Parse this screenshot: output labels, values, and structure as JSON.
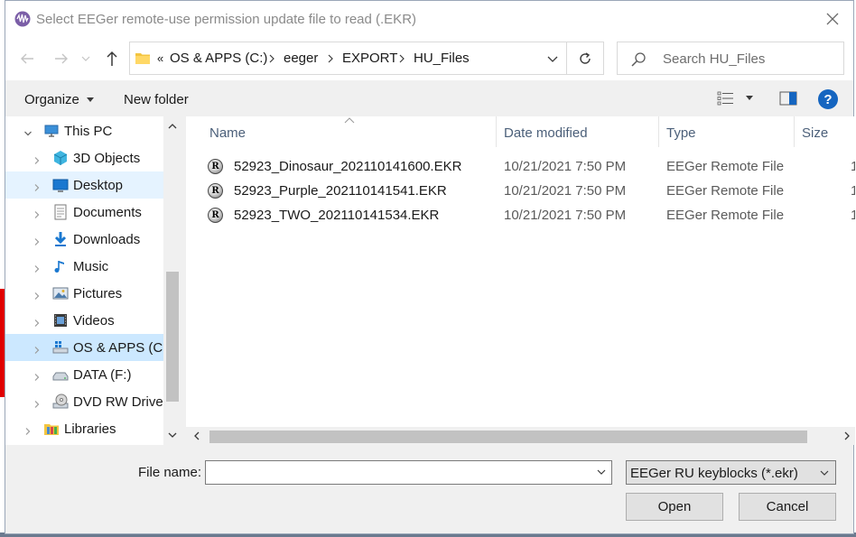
{
  "window": {
    "title": "Select EEGer remote-use permission update file to read (.EKR)"
  },
  "address": {
    "overflow": "«",
    "crumbs": [
      "OS & APPS (C:)",
      "eeger",
      "EXPORT",
      "HU_Files"
    ]
  },
  "search": {
    "placeholder": "Search HU_Files"
  },
  "toolbar": {
    "organize": "Organize",
    "new_folder": "New folder",
    "help": "?"
  },
  "nav": {
    "items": [
      {
        "label": "This PC",
        "icon": "computer-icon",
        "state": "expanded"
      },
      {
        "label": "3D Objects",
        "icon": "cube-icon"
      },
      {
        "label": "Desktop",
        "icon": "desktop-icon",
        "state": "hover"
      },
      {
        "label": "Documents",
        "icon": "documents-icon"
      },
      {
        "label": "Downloads",
        "icon": "download-icon"
      },
      {
        "label": "Music",
        "icon": "music-icon"
      },
      {
        "label": "Pictures",
        "icon": "pictures-icon"
      },
      {
        "label": "Videos",
        "icon": "videos-icon"
      },
      {
        "label": "OS & APPS (C:)",
        "icon": "drive-windows-icon",
        "state": "selected"
      },
      {
        "label": "DATA (F:)",
        "icon": "drive-icon"
      },
      {
        "label": "DVD RW Drive",
        "icon": "dvd-icon"
      },
      {
        "label": "Libraries",
        "icon": "libraries-icon"
      }
    ]
  },
  "columns": {
    "name": "Name",
    "date": "Date modified",
    "type": "Type",
    "size": "Size"
  },
  "files": [
    {
      "name": "52923_Dinosaur_202110141600.EKR",
      "date": "10/21/2021 7:50 PM",
      "type": "EEGer Remote File",
      "size": "1"
    },
    {
      "name": "52923_Purple_202110141541.EKR",
      "date": "10/21/2021 7:50 PM",
      "type": "EEGer Remote File",
      "size": "1"
    },
    {
      "name": "52923_TWO_202110141534.EKR",
      "date": "10/21/2021 7:50 PM",
      "type": "EEGer Remote File",
      "size": "1"
    }
  ],
  "file_icon_letter": "R",
  "footer": {
    "file_name_label": "File name:",
    "file_name_value": "",
    "filter": "EEGer RU keyblocks (*.ekr)",
    "open": "Open",
    "cancel": "Cancel"
  },
  "colors": {
    "selection": "#cce8ff",
    "hover": "#e5f3ff",
    "help": "#1565c0",
    "header_text": "#4c607a"
  }
}
